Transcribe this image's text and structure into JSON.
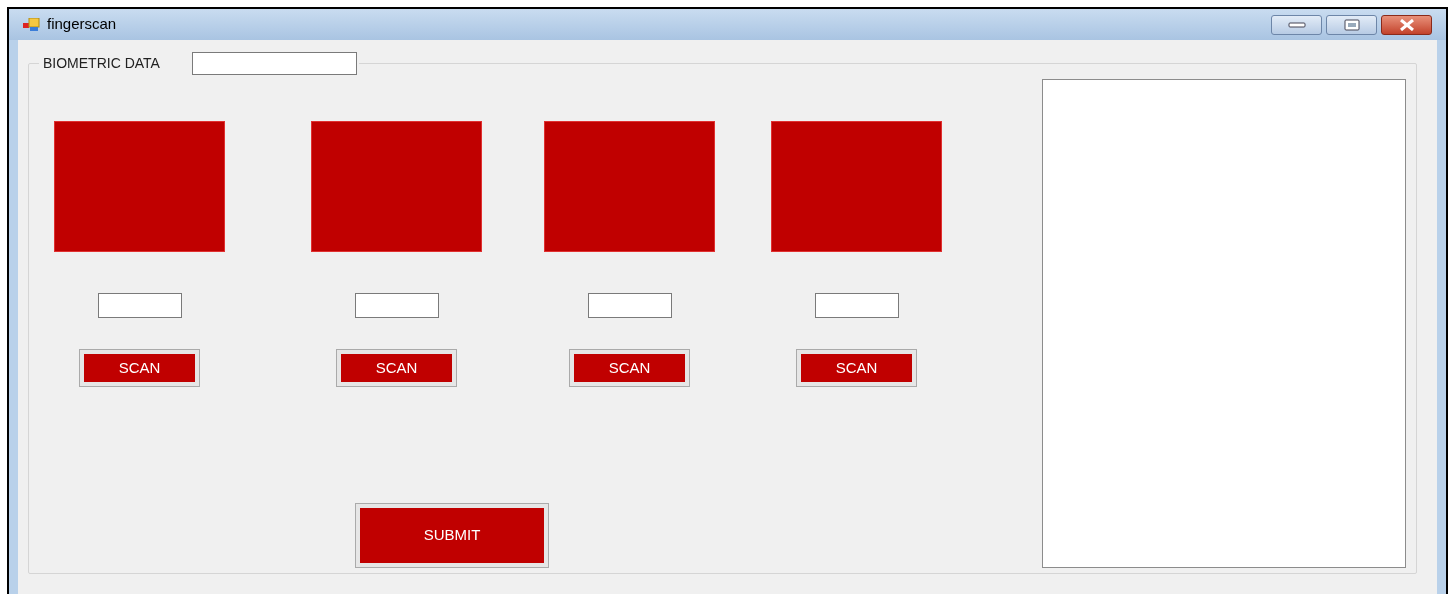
{
  "window": {
    "title": "fingerscan"
  },
  "group": {
    "label": "BIOMETRIC DATA"
  },
  "slots": [
    {
      "button": "SCAN"
    },
    {
      "button": "SCAN"
    },
    {
      "button": "SCAN"
    },
    {
      "button": "SCAN"
    }
  ],
  "submit": {
    "label": "SUBMIT"
  }
}
